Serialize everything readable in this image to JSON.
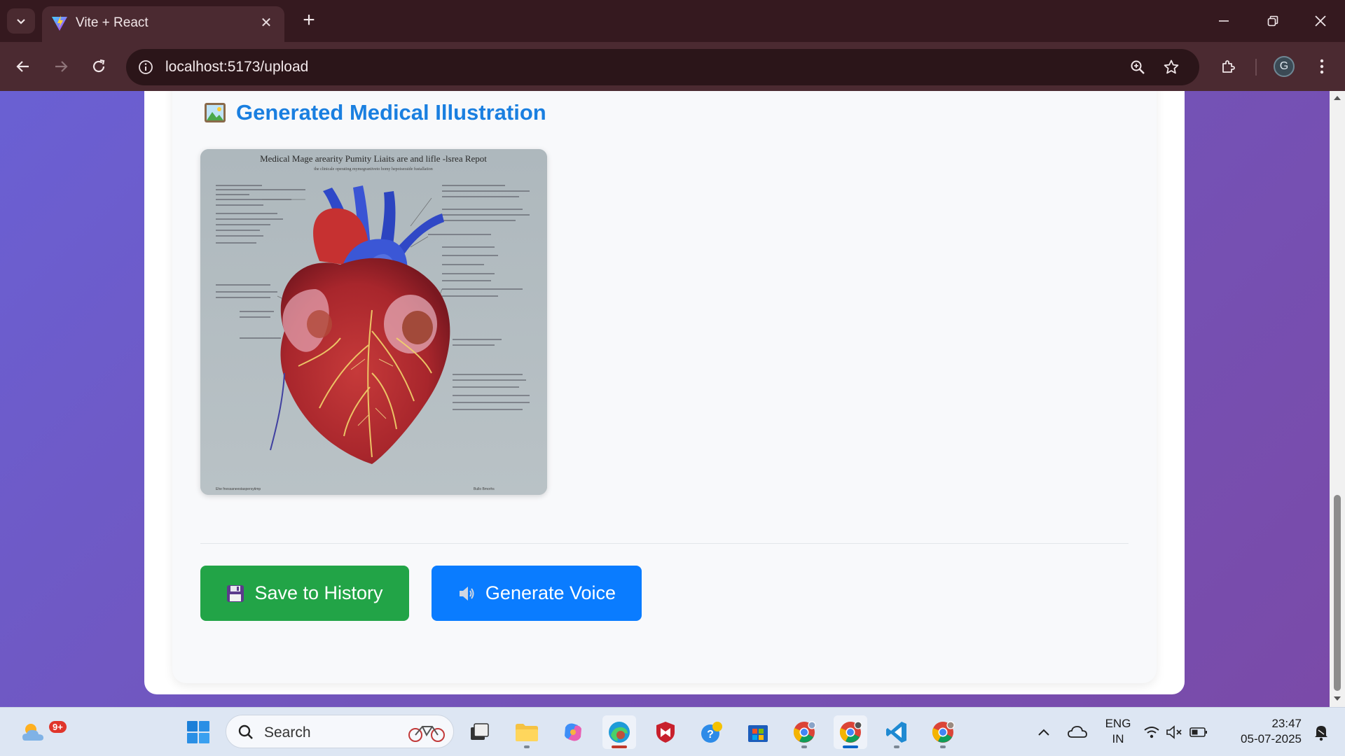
{
  "browser": {
    "tab_title": "Vite + React",
    "url": "localhost:5173/upload",
    "profile_initial": "G"
  },
  "page": {
    "section_title": "Generated Medical Illustration",
    "section_icon": "framed-picture-icon",
    "illustration": {
      "heading": "Medical Mage arearity Pumity Liaits  are  and  lifle  -lsrea Repot",
      "subtitle": "the  clinicale operating mymegrantiveto homy hepoiseraide fustallation",
      "footer_left": "Ehe fnessaneestaspersytimp",
      "footer_right": "Bullo Bmorhs"
    },
    "buttons": {
      "save_label": "Save to History",
      "save_icon": "floppy-disk-icon",
      "voice_label": "Generate Voice",
      "voice_icon": "speaker-icon"
    },
    "colors": {
      "title": "#1a7fe0",
      "save_button": "#22a447",
      "voice_button": "#0a7cff"
    }
  },
  "taskbar": {
    "weather_badge": "9+",
    "search_placeholder": "Search",
    "language_line1": "ENG",
    "language_line2": "IN",
    "time": "23:47",
    "date": "05-07-2025"
  }
}
